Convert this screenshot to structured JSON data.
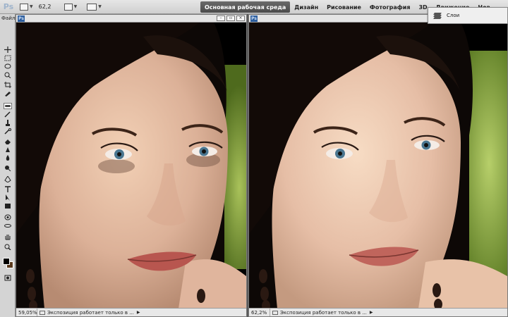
{
  "appbar": {
    "logo": "Ps",
    "zoom": "62,2",
    "workspaces": {
      "active": "Основная рабочая среда",
      "items": [
        "Дизайн",
        "Рисование",
        "Фотография",
        "3D",
        "Движение",
        "Нов"
      ]
    }
  },
  "layers_panel": {
    "label": "Слои"
  },
  "toolbar": {
    "file_menu": "Файл",
    "tools": [
      "move",
      "marquee",
      "lasso",
      "quick-select",
      "crop",
      "eyedropper",
      "spot-healing",
      "brush",
      "clone-stamp",
      "history-brush",
      "eraser",
      "gradient",
      "blur",
      "dodge",
      "pen",
      "type",
      "path-select",
      "shape",
      "3d-rotate",
      "3d-orbit",
      "hand",
      "zoom"
    ],
    "colors": {
      "foreground": "#000000",
      "background": "#5a3a1e"
    }
  },
  "documents": [
    {
      "ps_badge": "Ps",
      "zoom": "59,05%",
      "status": "Экспозиция работает только в ..."
    },
    {
      "ps_badge": "Ps",
      "zoom": "62,2%",
      "status": "Экспозиция работает только в ..."
    }
  ],
  "colors": {
    "accent": "#2d5e9e",
    "ui_bg": "#d4d4d4"
  }
}
